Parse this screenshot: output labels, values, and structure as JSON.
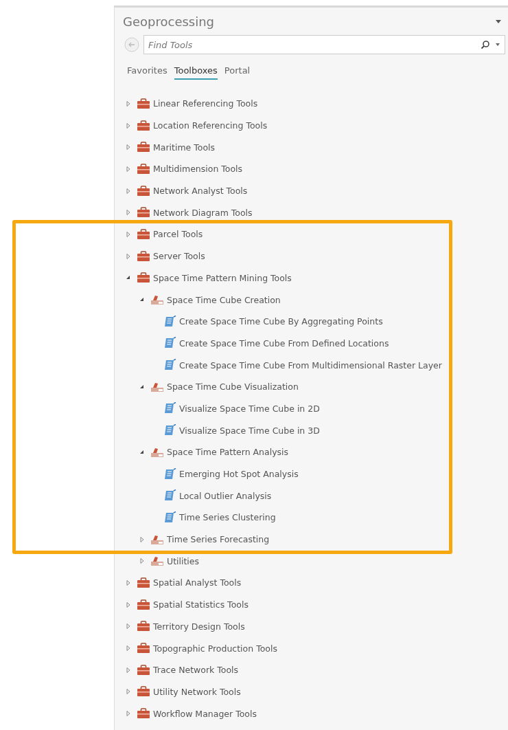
{
  "panel": {
    "title": "Geoprocessing"
  },
  "search": {
    "placeholder": "Find Tools"
  },
  "tabs": [
    {
      "label": "Favorites",
      "selected": false
    },
    {
      "label": "Toolboxes",
      "selected": true
    },
    {
      "label": "Portal",
      "selected": false
    }
  ],
  "tree": [
    {
      "kind": "toolbox",
      "label": "Linear Referencing Tools",
      "expanded": false
    },
    {
      "kind": "toolbox",
      "label": "Location Referencing Tools",
      "expanded": false
    },
    {
      "kind": "toolbox",
      "label": "Maritime Tools",
      "expanded": false
    },
    {
      "kind": "toolbox",
      "label": "Multidimension Tools",
      "expanded": false
    },
    {
      "kind": "toolbox",
      "label": "Network Analyst Tools",
      "expanded": false
    },
    {
      "kind": "toolbox",
      "label": "Network Diagram Tools",
      "expanded": false
    },
    {
      "kind": "toolbox",
      "label": "Parcel Tools",
      "expanded": false
    },
    {
      "kind": "toolbox",
      "label": "Server Tools",
      "expanded": false
    },
    {
      "kind": "toolbox",
      "label": "Space Time Pattern Mining Tools",
      "expanded": true,
      "children": [
        {
          "kind": "toolset",
          "label": "Space Time Cube Creation",
          "expanded": true,
          "children": [
            {
              "kind": "tool",
              "label": "Create Space Time Cube By Aggregating Points"
            },
            {
              "kind": "tool",
              "label": "Create Space Time Cube From Defined Locations"
            },
            {
              "kind": "tool",
              "label": "Create Space Time Cube From Multidimensional Raster Layer"
            }
          ]
        },
        {
          "kind": "toolset",
          "label": "Space Time Cube Visualization",
          "expanded": true,
          "children": [
            {
              "kind": "tool",
              "label": "Visualize Space Time Cube in 2D"
            },
            {
              "kind": "tool",
              "label": "Visualize Space Time Cube in 3D"
            }
          ]
        },
        {
          "kind": "toolset",
          "label": "Space Time Pattern Analysis",
          "expanded": true,
          "children": [
            {
              "kind": "tool",
              "label": "Emerging Hot Spot Analysis"
            },
            {
              "kind": "tool",
              "label": "Local Outlier Analysis"
            },
            {
              "kind": "tool",
              "label": "Time Series Clustering"
            }
          ]
        },
        {
          "kind": "toolset",
          "label": "Time Series Forecasting",
          "expanded": false
        },
        {
          "kind": "toolset",
          "label": "Utilities",
          "expanded": false
        }
      ]
    },
    {
      "kind": "toolbox",
      "label": "Spatial Analyst Tools",
      "expanded": false
    },
    {
      "kind": "toolbox",
      "label": "Spatial Statistics Tools",
      "expanded": false
    },
    {
      "kind": "toolbox",
      "label": "Territory Design Tools",
      "expanded": false
    },
    {
      "kind": "toolbox",
      "label": "Topographic Production Tools",
      "expanded": false
    },
    {
      "kind": "toolbox",
      "label": "Trace Network Tools",
      "expanded": false
    },
    {
      "kind": "toolbox",
      "label": "Utility Network Tools",
      "expanded": false
    },
    {
      "kind": "toolbox",
      "label": "Workflow Manager Tools",
      "expanded": false
    }
  ]
}
